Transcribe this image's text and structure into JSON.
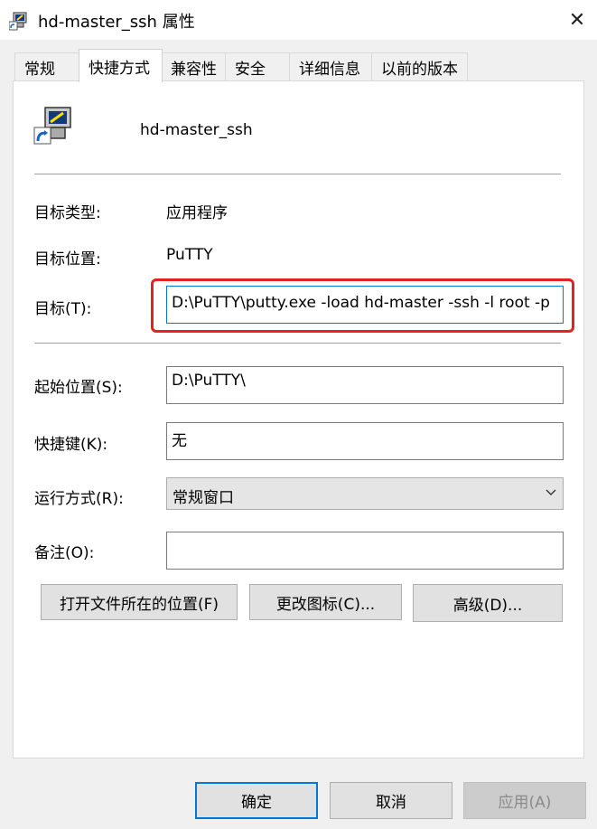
{
  "window": {
    "title": "hd-master_ssh 属性"
  },
  "tabs": [
    "常规",
    "快捷方式",
    "兼容性",
    "安全",
    "详细信息",
    "以前的版本"
  ],
  "shortcut": {
    "name": "hd-master_ssh"
  },
  "fields": {
    "target_type": {
      "label": "目标类型:",
      "value": "应用程序"
    },
    "target_location": {
      "label": "目标位置:",
      "value": "PuTTY"
    },
    "target": {
      "label": "目标(T):",
      "value": "D:\\PuTTY\\putty.exe -load hd-master -ssh -l root -p"
    },
    "start_in": {
      "label": "起始位置(S):",
      "value": "D:\\PuTTY\\"
    },
    "shortcut_key": {
      "label": "快捷键(K):",
      "value": "无"
    },
    "run": {
      "label": "运行方式(R):",
      "value": "常规窗口"
    },
    "comment": {
      "label": "备注(O):",
      "value": ""
    }
  },
  "actions": {
    "open_location": "打开文件所在的位置(F)",
    "change_icon": "更改图标(C)...",
    "advanced": "高级(D)..."
  },
  "footer": {
    "ok": "确定",
    "cancel": "取消",
    "apply": "应用(A)"
  },
  "colors": {
    "highlight": "#e32222",
    "focus": "#0078d7"
  }
}
